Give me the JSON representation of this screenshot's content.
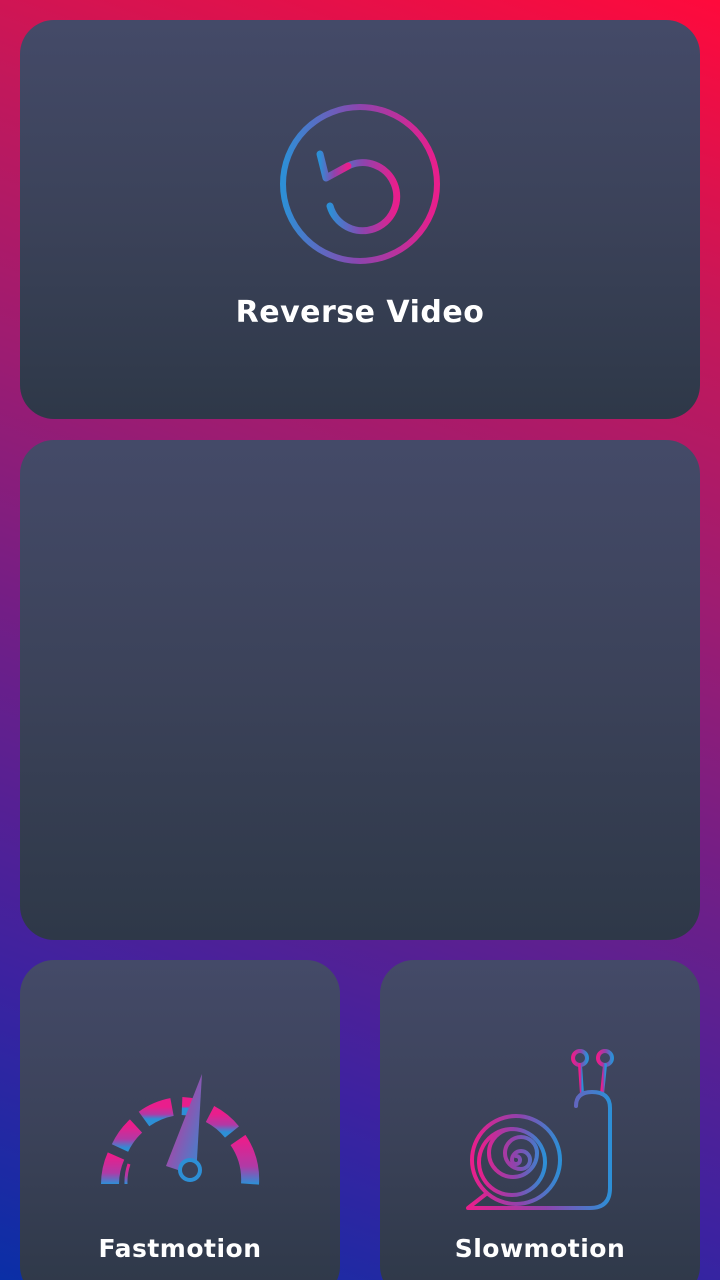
{
  "cards": {
    "reverse": {
      "label": "Reverse Video",
      "icon": "reverse-arrow-icon"
    },
    "middle": {
      "label": ""
    },
    "fastmotion": {
      "label": "Fastmotion",
      "icon": "speedometer-icon"
    },
    "slowmotion": {
      "label": "Slowmotion",
      "icon": "snail-icon"
    }
  },
  "colors": {
    "card_top": "#444a68",
    "card_bottom": "#2e3848",
    "accent_pink": "#e91e8c",
    "accent_purple": "#8e44ad",
    "accent_blue": "#2d8fd6",
    "label": "#ffffff"
  }
}
